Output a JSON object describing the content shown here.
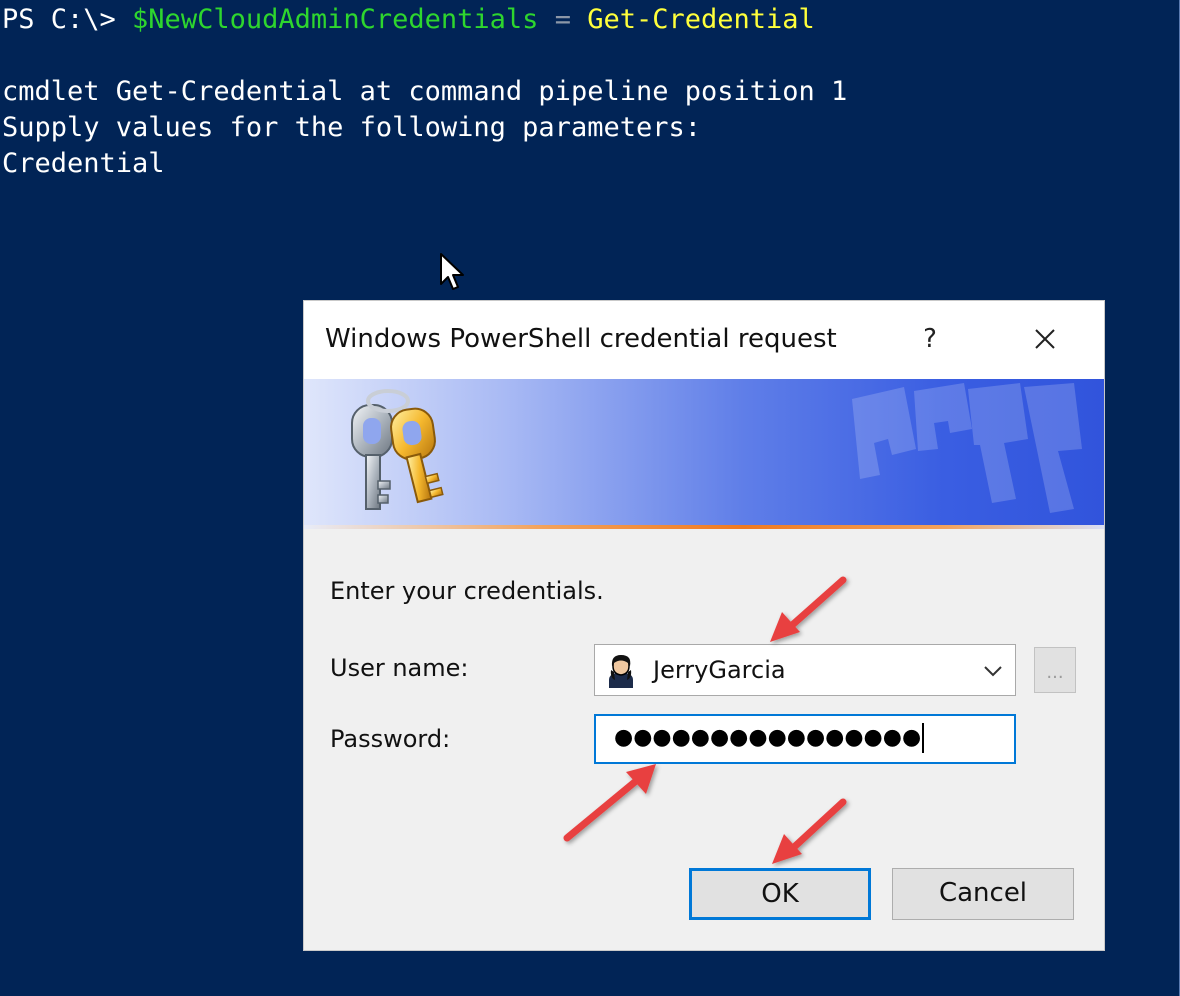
{
  "console": {
    "prompt": "PS C:\\> ",
    "variable": "$NewCloudAdminCredentials",
    "operator": " = ",
    "command": "Get-Credential",
    "output_lines": [
      "cmdlet Get-Credential at command pipeline position 1",
      "Supply values for the following parameters:",
      "Credential"
    ]
  },
  "dialog": {
    "title": "Windows PowerShell credential request",
    "help_label": "?",
    "close_label": "✕",
    "prompt_text": "Enter your credentials.",
    "username_label": "User name:",
    "username_value": "JerryGarcia",
    "browse_label": "...",
    "password_label": "Password:",
    "password_mask": "●●●●●●●●●●●●●●●●",
    "ok_label": "OK",
    "cancel_label": "Cancel"
  },
  "icons": {
    "banner": "keys-icon",
    "avatar": "user-avatar-icon",
    "dropdown": "chevron-down-icon",
    "pointer": "mouse-pointer-icon",
    "annotation": "red-arrow-icon"
  },
  "colors": {
    "console_bg": "#012456",
    "variable": "#2ed62e",
    "command": "#ffff3b",
    "accent": "#0078d7",
    "annotation_arrow": "#e8403f"
  }
}
